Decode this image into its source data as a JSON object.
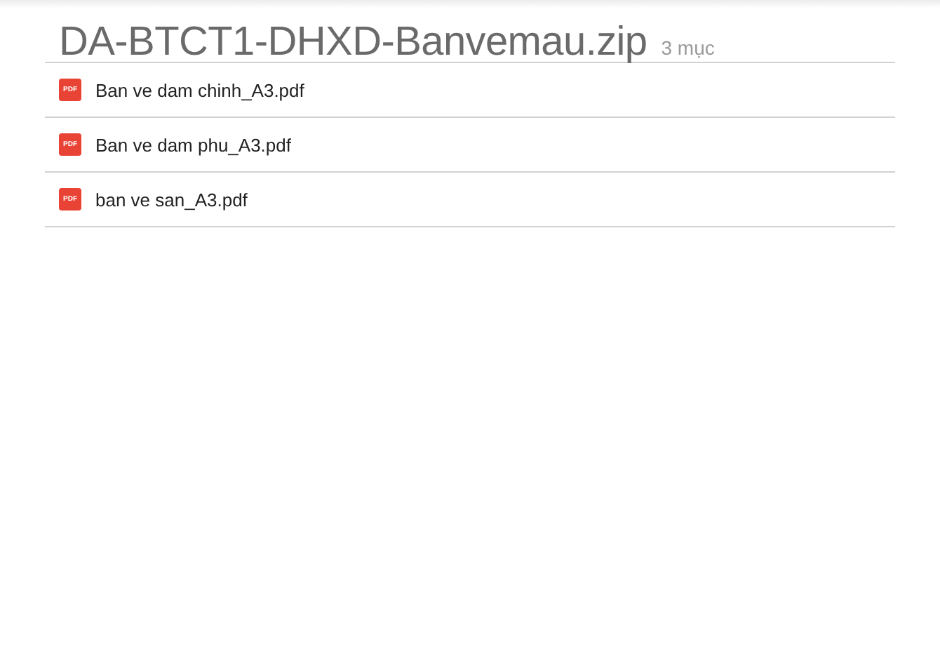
{
  "header": {
    "title": "DA-BTCT1-DHXD-Banvemau.zip",
    "count": "3 mục"
  },
  "files": [
    {
      "name": "Ban ve dam chinh_A3.pdf",
      "badge": "PDF"
    },
    {
      "name": "Ban ve dam phu_A3.pdf",
      "badge": "PDF"
    },
    {
      "name": "ban ve san_A3.pdf",
      "badge": "PDF"
    }
  ]
}
